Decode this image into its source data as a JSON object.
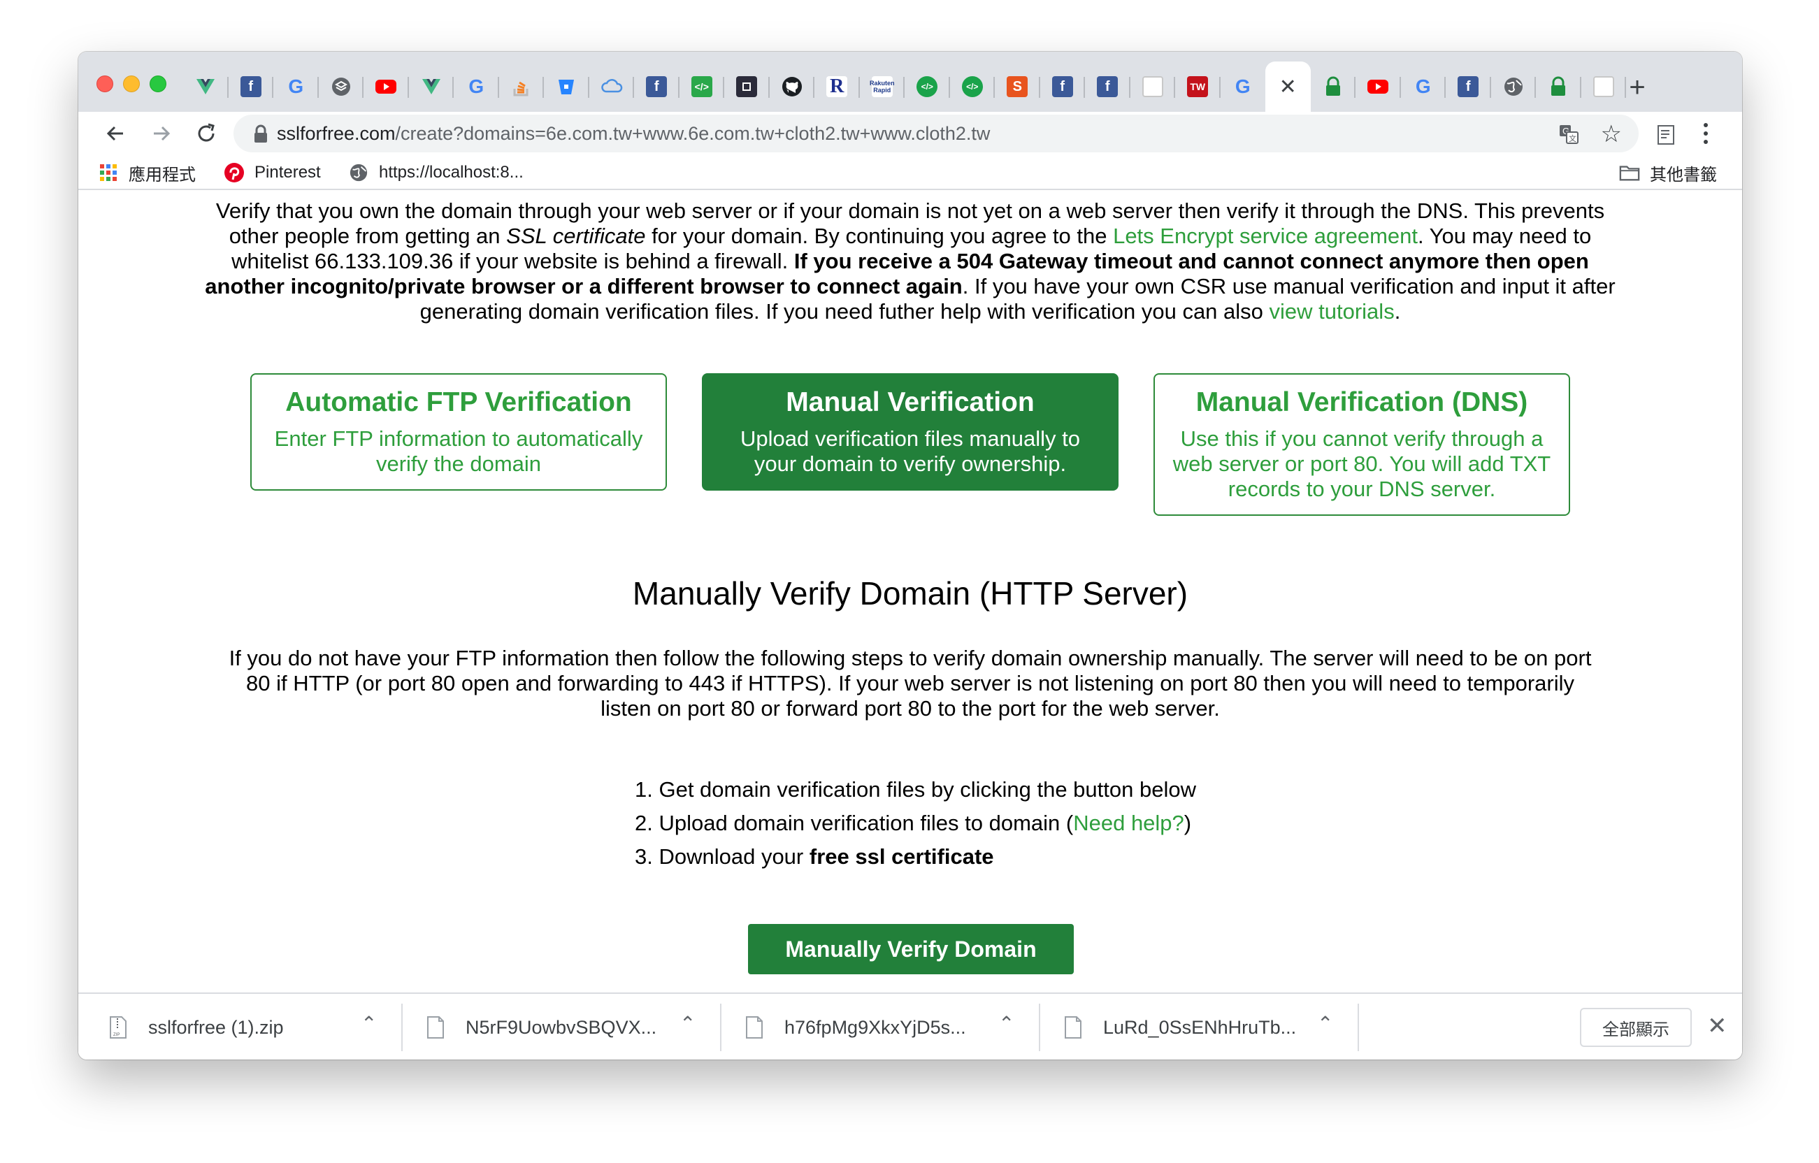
{
  "browser": {
    "tabs": [
      {
        "icon": "vue-icon"
      },
      {
        "icon": "facebook-icon"
      },
      {
        "icon": "google-icon"
      },
      {
        "icon": "layers-icon"
      },
      {
        "icon": "youtube-icon"
      },
      {
        "icon": "vue-icon"
      },
      {
        "icon": "google-icon"
      },
      {
        "icon": "stackoverflow-icon"
      },
      {
        "icon": "bitbucket-icon"
      },
      {
        "icon": "cloud-icon"
      },
      {
        "icon": "facebook-icon"
      },
      {
        "icon": "code-icon"
      },
      {
        "icon": "terminal-icon"
      },
      {
        "icon": "github-icon"
      },
      {
        "icon": "r-icon"
      },
      {
        "icon": "rakuten-icon"
      },
      {
        "icon": "code-circle-icon"
      },
      {
        "icon": "code-circle-icon"
      },
      {
        "icon": "shop-icon"
      },
      {
        "icon": "facebook-icon"
      },
      {
        "icon": "facebook-icon"
      },
      {
        "icon": "doc-icon"
      },
      {
        "icon": "tw-icon"
      },
      {
        "icon": "google-icon"
      },
      {
        "icon": "close-icon",
        "active": true
      },
      {
        "icon": "lock-icon"
      },
      {
        "icon": "youtube-icon"
      },
      {
        "icon": "google-icon"
      },
      {
        "icon": "facebook-icon"
      },
      {
        "icon": "globe-icon"
      },
      {
        "icon": "lock-icon"
      },
      {
        "icon": "doc-icon"
      }
    ],
    "new_tab_label": "+",
    "url_host": "sslforfree.com",
    "url_path": "/create?domains=6e.com.tw+www.6e.com.tw+cloth2.tw+www.cloth2.tw",
    "bookmarks": {
      "apps": "應用程式",
      "pinterest": "Pinterest",
      "localhost": "https://localhost:8...",
      "other": "其他書籤"
    }
  },
  "page": {
    "intro": {
      "p1": "Verify that you own the domain through your web server or if your domain is not yet on a web server then verify it through the DNS. This prevents other people from getting an ",
      "ssl_em": "SSL certificate",
      "p2": " for your domain. By continuing you agree to the ",
      "lets_encrypt_link": "Lets Encrypt service agreement",
      "p3": ". You may need to whitelist 66.133.109.36 if your website is behind a firewall. ",
      "bold": "If you receive a 504 Gateway timeout and cannot connect anymore then open another incognito/private browser or a different browser to connect again",
      "p4": ". If you have your own CSR use manual verification and input it after generating domain verification files. If you need futher help with verification you can also ",
      "tutorials_link": "view tutorials",
      "p5": "."
    },
    "options": [
      {
        "title": "Automatic FTP Verification",
        "desc": "Enter FTP information to automatically verify the domain"
      },
      {
        "title": "Manual Verification",
        "desc": "Upload verification files manually to your domain to verify ownership."
      },
      {
        "title": "Manual Verification (DNS)",
        "desc": "Use this if you cannot verify through a web server or port 80. You will add TXT records to your DNS server."
      }
    ],
    "section_heading": "Manually Verify Domain (HTTP Server)",
    "section_text": "If you do not have your FTP information then follow the following steps to verify domain ownership manually. The server will need to be on port 80 if HTTP (or port 80 open and forwarding to 443 if HTTPS). If your web server is not listening on port 80 then you will need to temporarily listen on port 80 or forward port 80 to the port for the web server.",
    "steps": {
      "s1": "1. Get domain verification files by clicking the button below",
      "s2_pre": "2. Upload domain verification files to domain (",
      "s2_link": "Need help?",
      "s2_post": ")",
      "s3_pre": "3. Download your ",
      "s3_bold": "free ssl certificate"
    },
    "verify_button": "Manually Verify Domain"
  },
  "downloads": {
    "items": [
      {
        "name": "sslforfree (1).zip"
      },
      {
        "name": "N5rF9UowbvSBQVX..."
      },
      {
        "name": "h76fpMg9XkxYjD5s..."
      },
      {
        "name": "LuRd_0SsENhHruTb..."
      }
    ],
    "show_all": "全部顯示"
  },
  "colors": {
    "accent_green": "#2e9e3c",
    "button_green": "#22803a"
  }
}
